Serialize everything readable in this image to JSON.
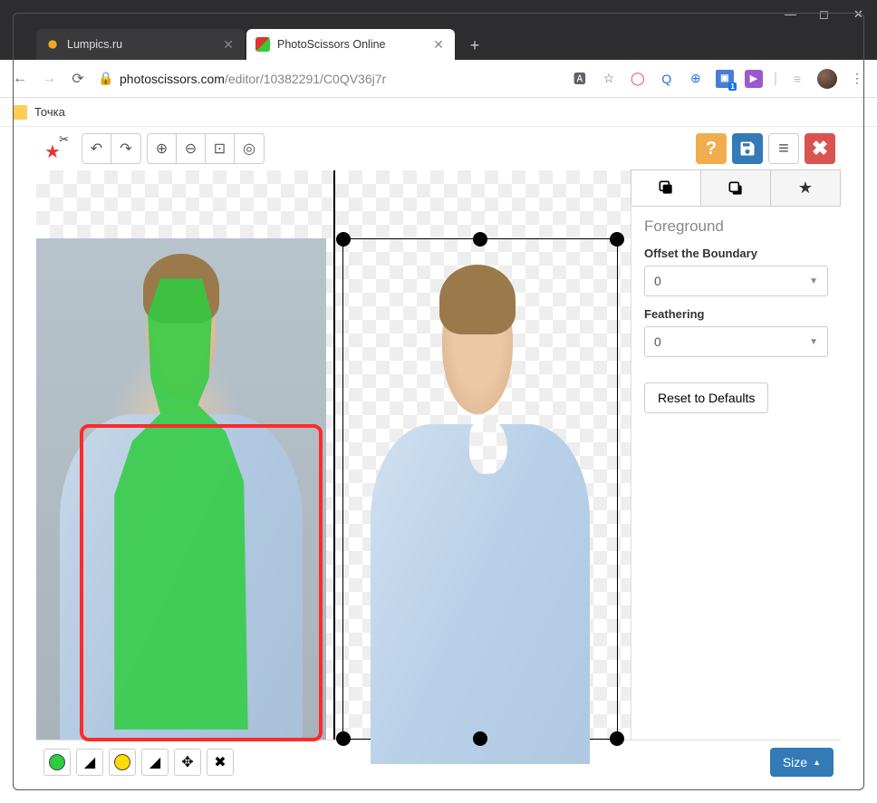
{
  "browser": {
    "tabs": [
      {
        "title": "Lumpics.ru",
        "active": false
      },
      {
        "title": "PhotoScissors Online",
        "active": true
      }
    ],
    "url_host": "photoscissors.com",
    "url_path": "/editor/10382291/C0QV36j7r",
    "bookmark": "Точка"
  },
  "toolbar": {
    "undo_title": "Undo",
    "redo_title": "Redo",
    "zoom_in_title": "Zoom In",
    "zoom_out_title": "Zoom Out",
    "zoom_fit_title": "Fit",
    "zoom_actual_title": "Actual Size",
    "help": "?",
    "menu": "≡",
    "close": "✖"
  },
  "panel": {
    "heading": "Foreground",
    "offset_label": "Offset the Boundary",
    "offset_value": "0",
    "feather_label": "Feathering",
    "feather_value": "0",
    "reset": "Reset to Defaults"
  },
  "bottom": {
    "size_btn": "Size"
  }
}
